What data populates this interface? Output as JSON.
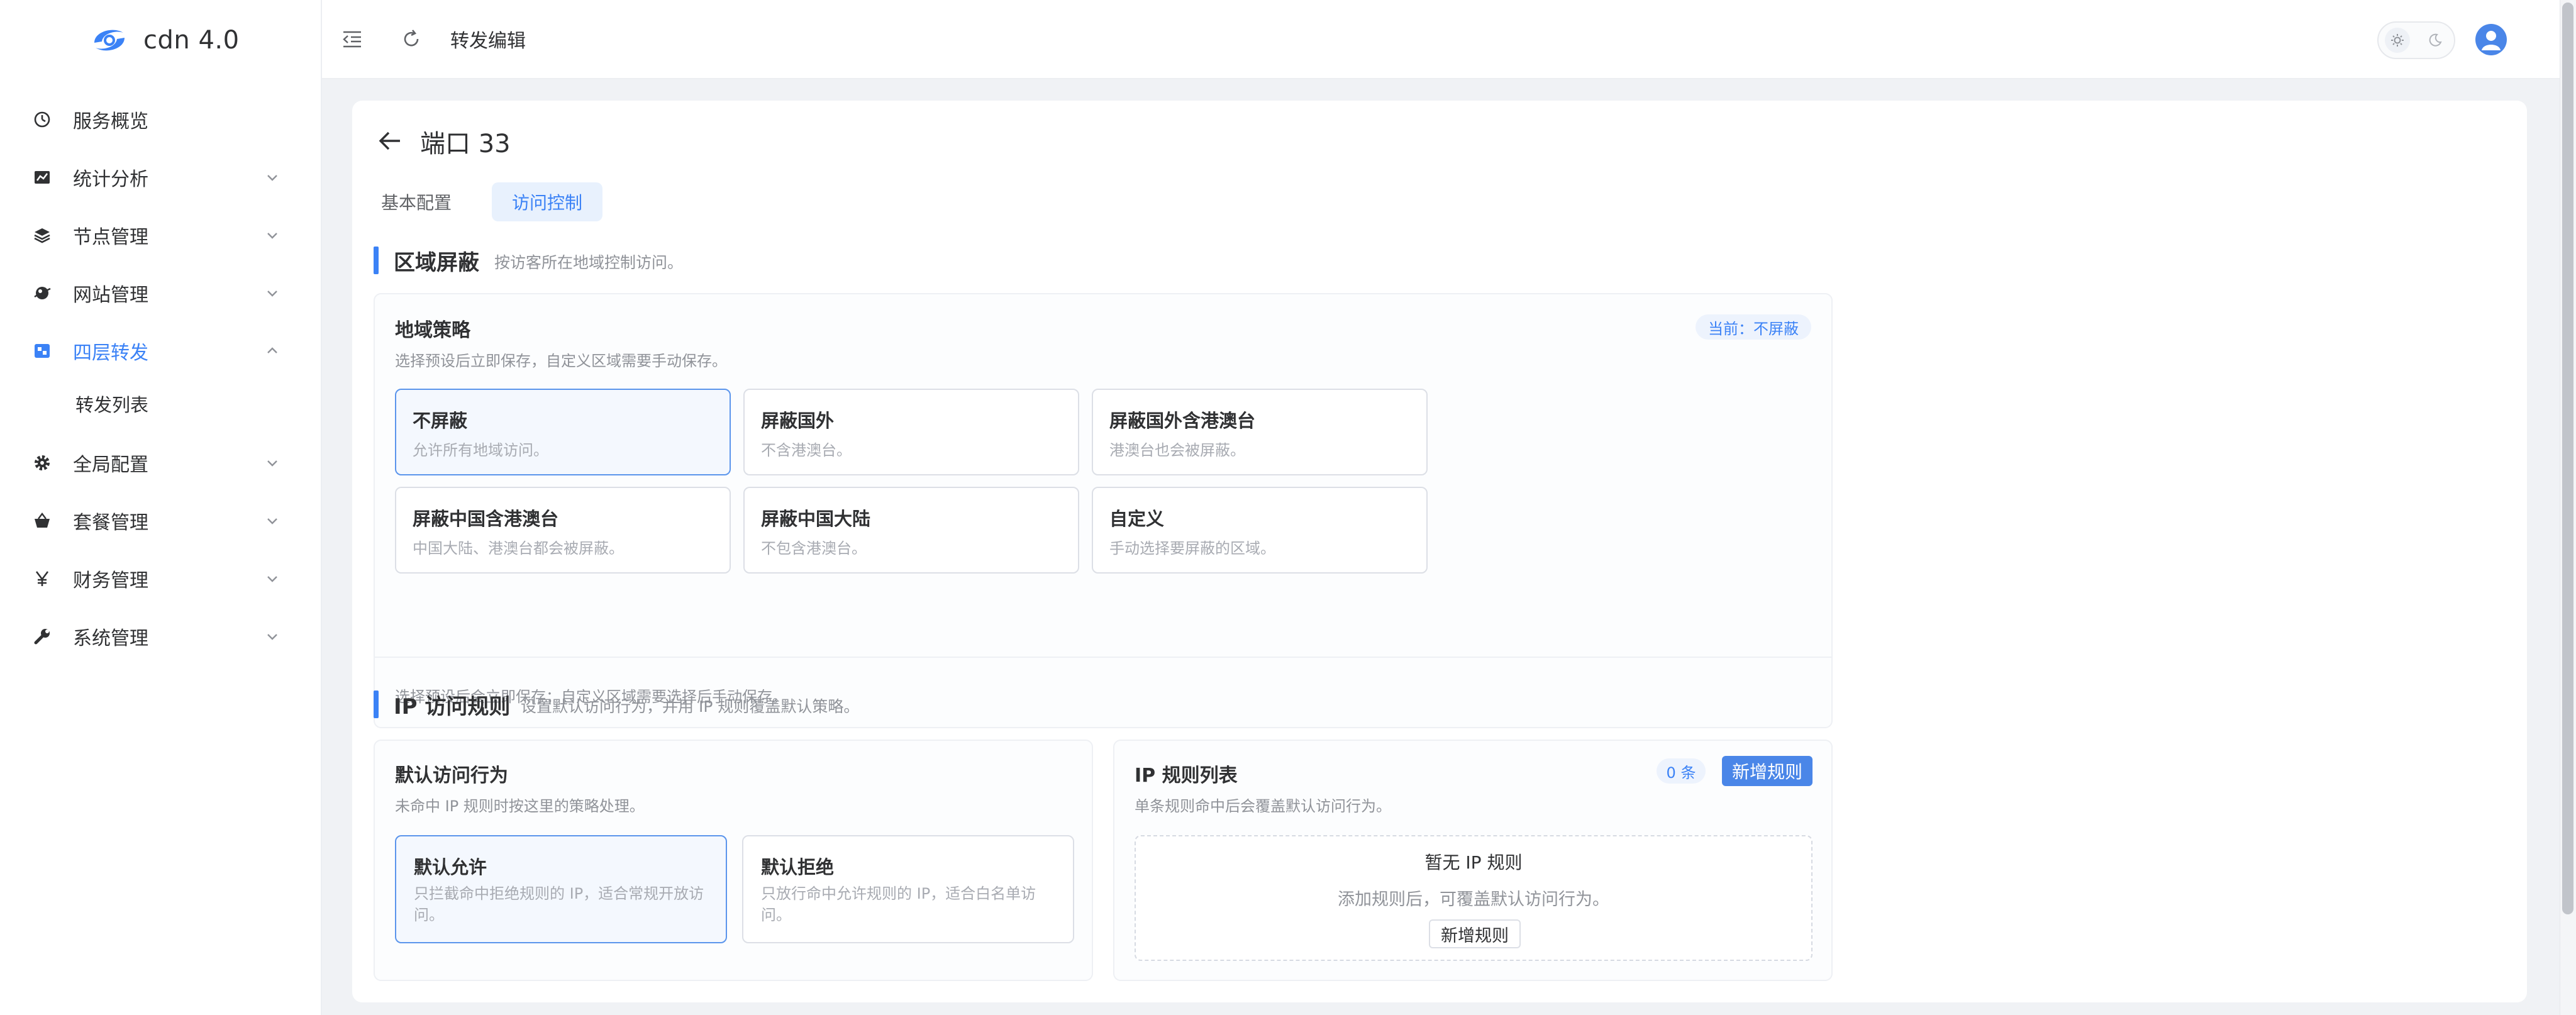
{
  "app": {
    "title": "cdn 4.0"
  },
  "sidebar": {
    "items": [
      {
        "label": "服务概览",
        "icon": "dashboard-icon"
      },
      {
        "label": "统计分析",
        "icon": "chart-icon"
      },
      {
        "label": "节点管理",
        "icon": "layers-icon"
      },
      {
        "label": "网站管理",
        "icon": "globe-icon"
      },
      {
        "label": "四层转发",
        "icon": "forward-icon"
      },
      {
        "label": "全局配置",
        "icon": "gear-icon"
      },
      {
        "label": "套餐管理",
        "icon": "basket-icon"
      },
      {
        "label": "财务管理",
        "icon": "yen-icon"
      },
      {
        "label": "系统管理",
        "icon": "wrench-icon"
      }
    ],
    "sub_items": [
      {
        "label": "转发列表"
      }
    ],
    "active": "四层转发"
  },
  "topbar": {
    "page_title": "转发编辑"
  },
  "page": {
    "title": "端口 33",
    "tabs": [
      {
        "label": "基本配置"
      },
      {
        "label": "访问控制"
      }
    ],
    "active_tab": "访问控制"
  },
  "region": {
    "title": "区域屏蔽",
    "desc": "按访客所在地域控制访问。",
    "panel_title": "地域策略",
    "panel_desc": "选择预设后立即保存，自定义区域需要手动保存。",
    "current_badge": "当前：不屏蔽",
    "options": [
      {
        "title": "不屏蔽",
        "desc": "允许所有地域访问。"
      },
      {
        "title": "屏蔽国外",
        "desc": "不含港澳台。"
      },
      {
        "title": "屏蔽国外含港澳台",
        "desc": "港澳台也会被屏蔽。"
      },
      {
        "title": "屏蔽中国含港澳台",
        "desc": "中国大陆、港澳台都会被屏蔽。"
      },
      {
        "title": "屏蔽中国大陆",
        "desc": "不包含港澳台。"
      },
      {
        "title": "自定义",
        "desc": "手动选择要屏蔽的区域。"
      }
    ],
    "selected": "不屏蔽",
    "footnote": "选择预设后会立即保存；自定义区域需要选择后手动保存。"
  },
  "ip": {
    "title": "IP 访问规则",
    "desc": "设置默认访问行为，并用 IP 规则覆盖默认策略。",
    "default": {
      "title": "默认访问行为",
      "desc": "未命中 IP 规则时按这里的策略处理。",
      "options": [
        {
          "title": "默认允许",
          "desc": "只拦截命中拒绝规则的 IP，适合常规开放访问。"
        },
        {
          "title": "默认拒绝",
          "desc": "只放行命中允许规则的 IP，适合白名单访问。"
        }
      ],
      "selected": "默认允许"
    },
    "rules": {
      "title": "IP 规则列表",
      "desc": "单条规则命中后会覆盖默认访问行为。",
      "count": "0 条",
      "add_label": "新增规则",
      "empty_title": "暂无 IP 规则",
      "empty_desc": "添加规则后，可覆盖默认访问行为。",
      "empty_add_label": "新增规则"
    }
  },
  "colors": {
    "accent": "#3b82f6",
    "background": "#f0f2f5"
  }
}
